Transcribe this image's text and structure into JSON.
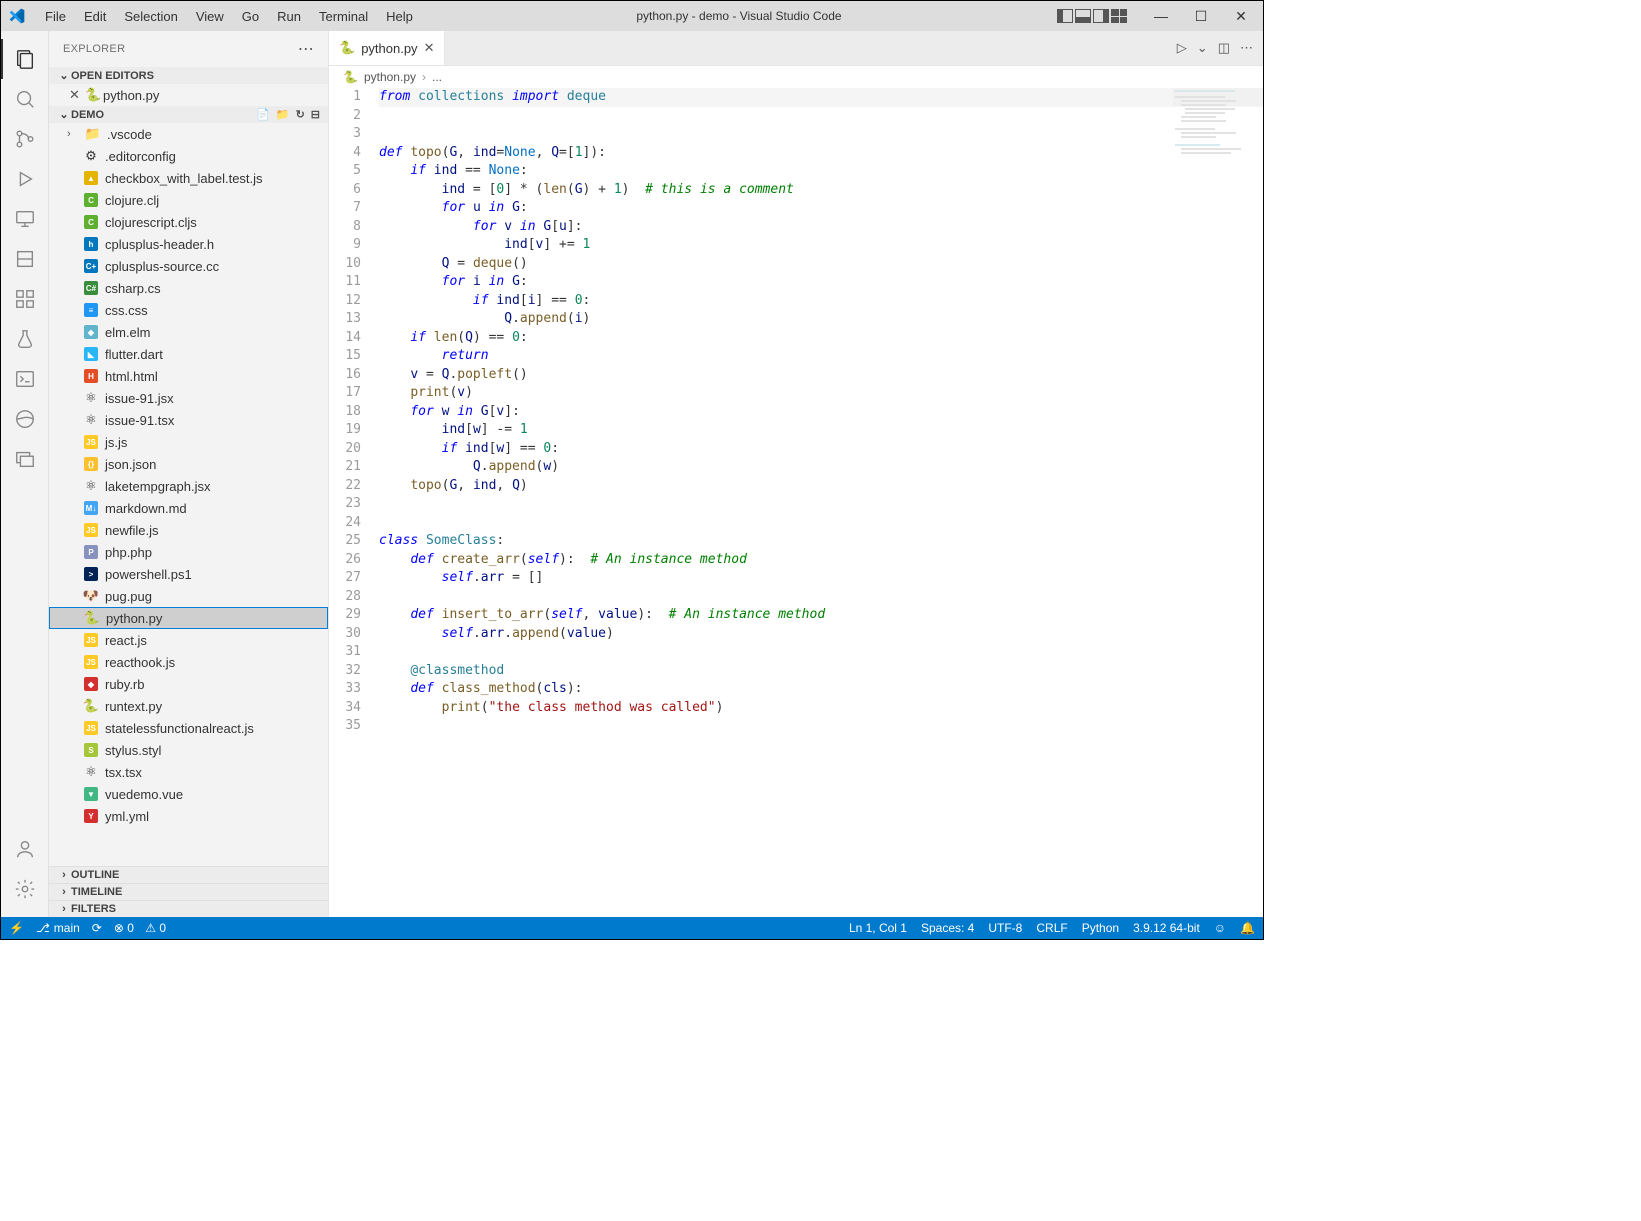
{
  "title": "python.py - demo - Visual Studio Code",
  "menus": [
    "File",
    "Edit",
    "Selection",
    "View",
    "Go",
    "Run",
    "Terminal",
    "Help"
  ],
  "sidebar": {
    "header": "EXPLORER",
    "open_editors_label": "OPEN EDITORS",
    "open_editor_file": "python.py",
    "root_folder": "DEMO",
    "folders": [
      ".vscode"
    ],
    "files": [
      {
        "name": ".editorconfig",
        "color": "#999",
        "glyph": "⚙"
      },
      {
        "name": "checkbox_with_label.test.js",
        "color": "#e4b400",
        "glyph": "▲"
      },
      {
        "name": "clojure.clj",
        "color": "#5fb030",
        "glyph": "C"
      },
      {
        "name": "clojurescript.cljs",
        "color": "#5fb030",
        "glyph": "C"
      },
      {
        "name": "cplusplus-header.h",
        "color": "#0277bd",
        "glyph": "h"
      },
      {
        "name": "cplusplus-source.cc",
        "color": "#0277bd",
        "glyph": "C+"
      },
      {
        "name": "csharp.cs",
        "color": "#388e3c",
        "glyph": "C#"
      },
      {
        "name": "css.css",
        "color": "#2196f3",
        "glyph": "≡"
      },
      {
        "name": "elm.elm",
        "color": "#60b5cc",
        "glyph": "◆"
      },
      {
        "name": "flutter.dart",
        "color": "#29b6f6",
        "glyph": "◣"
      },
      {
        "name": "html.html",
        "color": "#e44d26",
        "glyph": "H"
      },
      {
        "name": "issue-91.jsx",
        "color": "#00bcd4",
        "glyph": "⚛"
      },
      {
        "name": "issue-91.tsx",
        "color": "#00bcd4",
        "glyph": "⚛"
      },
      {
        "name": "js.js",
        "color": "#ffca28",
        "glyph": "JS"
      },
      {
        "name": "json.json",
        "color": "#fbc02d",
        "glyph": "{}"
      },
      {
        "name": "laketempgraph.jsx",
        "color": "#00bcd4",
        "glyph": "⚛"
      },
      {
        "name": "markdown.md",
        "color": "#42a5f5",
        "glyph": "M↓"
      },
      {
        "name": "newfile.js",
        "color": "#ffca28",
        "glyph": "JS"
      },
      {
        "name": "php.php",
        "color": "#8892bf",
        "glyph": "P"
      },
      {
        "name": "powershell.ps1",
        "color": "#012456",
        "glyph": ">"
      },
      {
        "name": "pug.pug",
        "color": "#c39",
        "glyph": "🐶"
      },
      {
        "name": "python.py",
        "color": "#3776ab",
        "glyph": "🐍",
        "selected": true
      },
      {
        "name": "react.js",
        "color": "#ffca28",
        "glyph": "JS"
      },
      {
        "name": "reacthook.js",
        "color": "#ffca28",
        "glyph": "JS"
      },
      {
        "name": "ruby.rb",
        "color": "#d32f2f",
        "glyph": "◆"
      },
      {
        "name": "runtext.py",
        "color": "#3776ab",
        "glyph": "🐍"
      },
      {
        "name": "statelessfunctionalreact.js",
        "color": "#ffca28",
        "glyph": "JS"
      },
      {
        "name": "stylus.styl",
        "color": "#a4c639",
        "glyph": "S"
      },
      {
        "name": "tsx.tsx",
        "color": "#00bcd4",
        "glyph": "⚛"
      },
      {
        "name": "vuedemo.vue",
        "color": "#41b883",
        "glyph": "▼"
      },
      {
        "name": "yml.yml",
        "color": "#d32f2f",
        "glyph": "Y"
      }
    ],
    "outline": "OUTLINE",
    "timeline": "TIMELINE",
    "filters": "FILTERS"
  },
  "tab": {
    "name": "python.py"
  },
  "breadcrumb": {
    "file": "python.py",
    "tail": "..."
  },
  "status": {
    "remote": "⚡",
    "branch": "main",
    "sync": "⟳",
    "errors": "⊗ 0",
    "warnings": "⚠ 0",
    "lncol": "Ln 1, Col 1",
    "spaces": "Spaces: 4",
    "enc": "UTF-8",
    "eol": "CRLF",
    "lang": "Python",
    "pyver": "3.9.12 64-bit",
    "feedback": "☺",
    "bell": "🔔"
  }
}
